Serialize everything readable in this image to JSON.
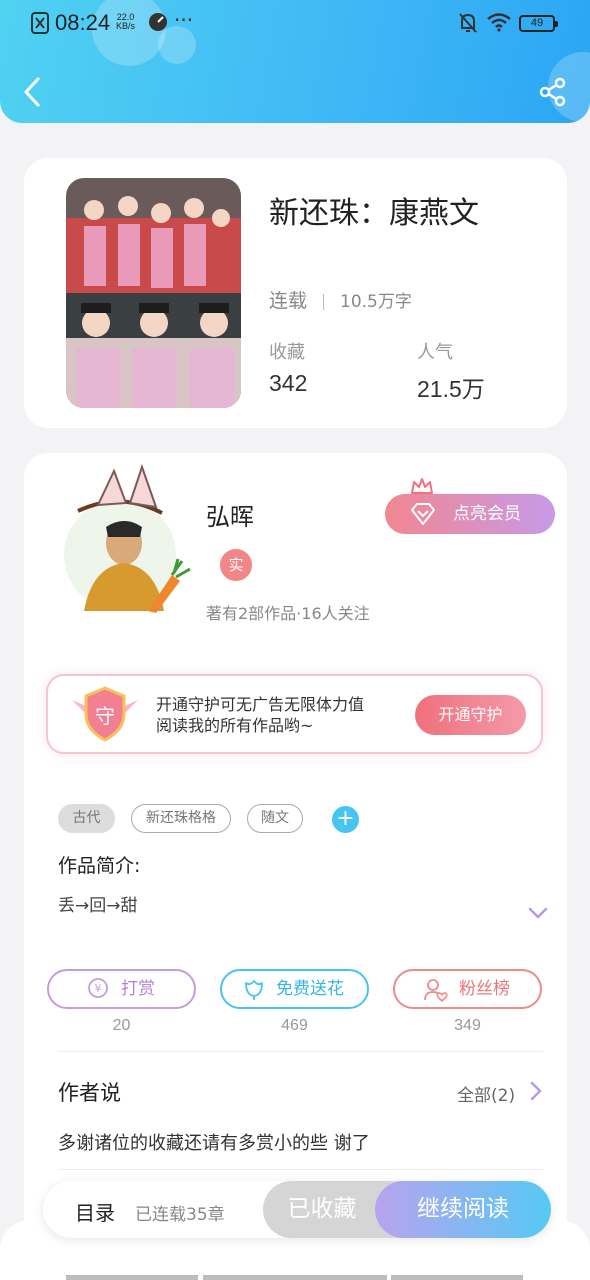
{
  "status_bar": {
    "time": "08:24",
    "speed_value": "22.0",
    "speed_unit": "KB/s",
    "more": "···",
    "battery": "49"
  },
  "book": {
    "title": "新还珠：康燕文",
    "status": "连载",
    "word_count": "10.5万字",
    "favorites_label": "收藏",
    "favorites_value": "342",
    "popularity_label": "人气",
    "popularity_value": "21.5万"
  },
  "author": {
    "name": "弘晖",
    "badge": "实",
    "meta": "著有2部作品·16人关注",
    "vip_button": "点亮会员"
  },
  "guard": {
    "icon_text": "守",
    "line1": "开通守护可无广告无限体力值",
    "line2": "阅读我的所有作品哟~",
    "button": "开通守护"
  },
  "tags": [
    "古代",
    "新还珠格格",
    "随文"
  ],
  "add_tag": "+",
  "intro": {
    "title": "作品简介:",
    "text": "丢→回→甜"
  },
  "actions": [
    {
      "label": "打赏",
      "count": "20",
      "color": "#c79be0"
    },
    {
      "label": "免费送花",
      "count": "469",
      "color": "#45c5ef"
    },
    {
      "label": "粉丝榜",
      "count": "349",
      "color": "#ef8a8a"
    }
  ],
  "author_says": {
    "title": "作者说",
    "all_label": "全部(2)",
    "text": "多谢诸位的收藏还请有多赏小的些 谢了"
  },
  "bottom_bar": {
    "toc": "目录",
    "chapters": "已连载35章",
    "favorited": "已收藏",
    "continue": "继续阅读"
  }
}
